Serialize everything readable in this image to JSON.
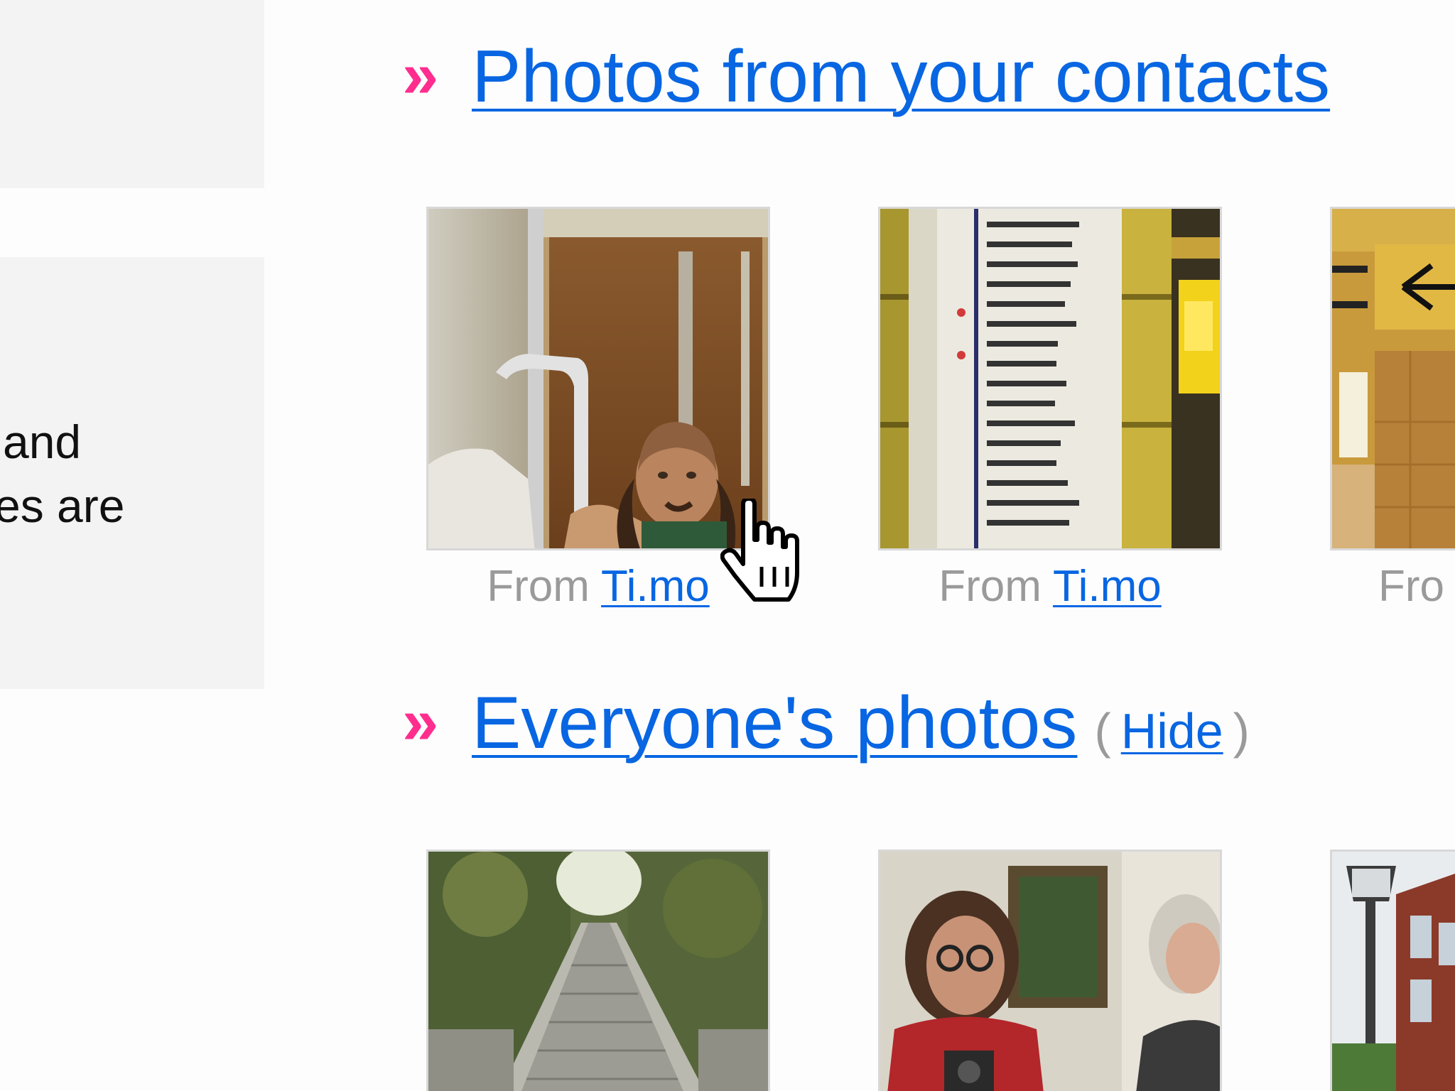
{
  "sidebar": {
    "text_line1": "and",
    "text_line2": "es are"
  },
  "sections": {
    "contacts": {
      "raquo": "»",
      "title": "Photos from your contacts",
      "items": [
        {
          "from": "From",
          "user": "Ti.mo"
        },
        {
          "from": "From",
          "user": "Ti.mo"
        },
        {
          "from": "Fro"
        }
      ]
    },
    "everyone": {
      "raquo": "»",
      "title": "Everyone's photos",
      "hide_open": "(",
      "hide": "Hide",
      "hide_close": ")"
    }
  },
  "colors": {
    "link": "#0866e2",
    "accent": "#ff2d8e",
    "muted": "#9a9a9a"
  }
}
